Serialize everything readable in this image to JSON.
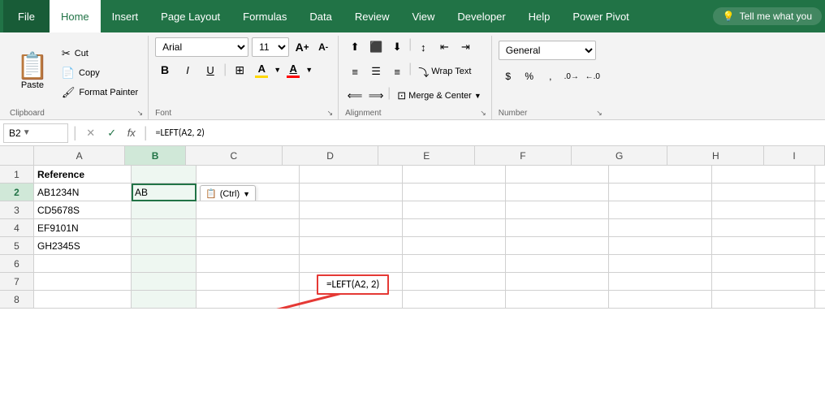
{
  "menubar": {
    "file_label": "File",
    "tabs": [
      "Home",
      "Insert",
      "Page Layout",
      "Formulas",
      "Data",
      "Review",
      "View",
      "Developer",
      "Help",
      "Power Pivot"
    ],
    "active_tab": "Home",
    "tell_me": "Tell me what you",
    "lightbulb": "💡"
  },
  "ribbon": {
    "clipboard": {
      "group_label": "Clipboard",
      "paste_label": "Paste",
      "cut_label": "Cut",
      "copy_label": "Copy",
      "format_painter_label": "Format Painter"
    },
    "font": {
      "group_label": "Font",
      "font_name": "Arial",
      "font_size": "11",
      "bold": "B",
      "italic": "I",
      "underline": "U",
      "increase_size": "A",
      "decrease_size": "A"
    },
    "alignment": {
      "group_label": "Alignment",
      "wrap_text": "Wrap Text",
      "merge_center": "Merge & Center"
    },
    "number": {
      "group_label": "Number",
      "format": "General"
    }
  },
  "formula_bar": {
    "cell_ref": "B2",
    "formula": "=LEFT(A2, 2)"
  },
  "columns": [
    "A",
    "B",
    "C",
    "D",
    "E",
    "F",
    "G",
    "H",
    "I"
  ],
  "rows": [
    1,
    2,
    3,
    4,
    5,
    6,
    7,
    8
  ],
  "cells": {
    "A1": "Reference",
    "A2": "AB1234N",
    "A3": "CD5678S",
    "A4": "EF9101N",
    "A5": "GH2345S",
    "B2": "AB"
  },
  "paste_options": {
    "label": "(Ctrl)",
    "icon": "📋"
  },
  "annotation": {
    "formula_text": "=LEFT(A2, 2)"
  },
  "active_cell": "B2",
  "active_col": "B"
}
